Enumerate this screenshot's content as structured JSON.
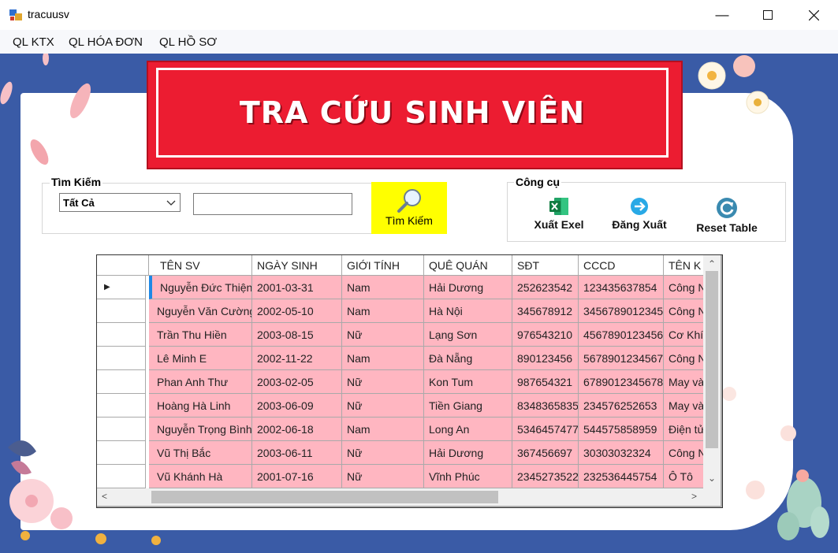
{
  "window": {
    "title": "tracuusv"
  },
  "menu": [
    "QL KTX",
    "QL HÓA ĐƠN",
    "QL HỒ SƠ"
  ],
  "banner": {
    "title": "TRA CỨU SINH VIÊN"
  },
  "search_group": {
    "legend": "Tìm Kiếm",
    "combo_value": "Tất Cả",
    "input_value": "",
    "button_label": "Tìm Kiếm"
  },
  "tools_group": {
    "legend": "Công cụ",
    "export_label": "Xuất Exel",
    "logout_label": "Đăng Xuất",
    "reset_label": "Reset Table"
  },
  "colors": {
    "background": "#3a5ba6",
    "banner": "#ec1c31",
    "row": "#ffb6c1",
    "search_button": "#ffff00"
  },
  "grid": {
    "columns": [
      "TÊN SV",
      "NGÀY SINH",
      "GIỚI TÍNH",
      "QUÊ QUÁN",
      "SĐT",
      "CCCD",
      "TÊN K"
    ],
    "rows": [
      [
        "Nguyễn Đức Thiện",
        "2001-03-31",
        "Nam",
        "Hải Dương",
        "252623542",
        "123435637854",
        "Công N"
      ],
      [
        "Nguyễn Văn Cường",
        "2002-05-10",
        "Nam",
        "Hà Nội",
        "345678912",
        "3456789012345",
        "Công N"
      ],
      [
        "Trần Thu Hiền",
        "2003-08-15",
        "Nữ",
        "Lạng Sơn",
        "976543210",
        "4567890123456",
        "Cơ Khí"
      ],
      [
        "Lê Minh E",
        "2002-11-22",
        "Nam",
        "Đà Nẵng",
        "890123456",
        "5678901234567",
        "Công N"
      ],
      [
        "Phan Anh Thư",
        "2003-02-05",
        "Nữ",
        "Kon Tum",
        "987654321",
        "6789012345678",
        "May và"
      ],
      [
        "Hoàng Hà Linh",
        "2003-06-09",
        "Nữ",
        "Tiền Giang",
        "8348365835",
        "234576252653",
        "May và"
      ],
      [
        "Nguyễn Trọng Bình",
        "2002-06-18",
        "Nam",
        "Long An",
        "5346457477",
        "544575858959",
        "Điện tử"
      ],
      [
        "Vũ Thị Bắc",
        "2003-06-11",
        "Nữ",
        "Hải Dương",
        "367456697",
        "30303032324",
        "Công N"
      ],
      [
        "Vũ Khánh Hà",
        "2001-07-16",
        "Nữ",
        "Vĩnh Phúc",
        "2345273522",
        "232536445754",
        "Ô Tô"
      ]
    ]
  }
}
